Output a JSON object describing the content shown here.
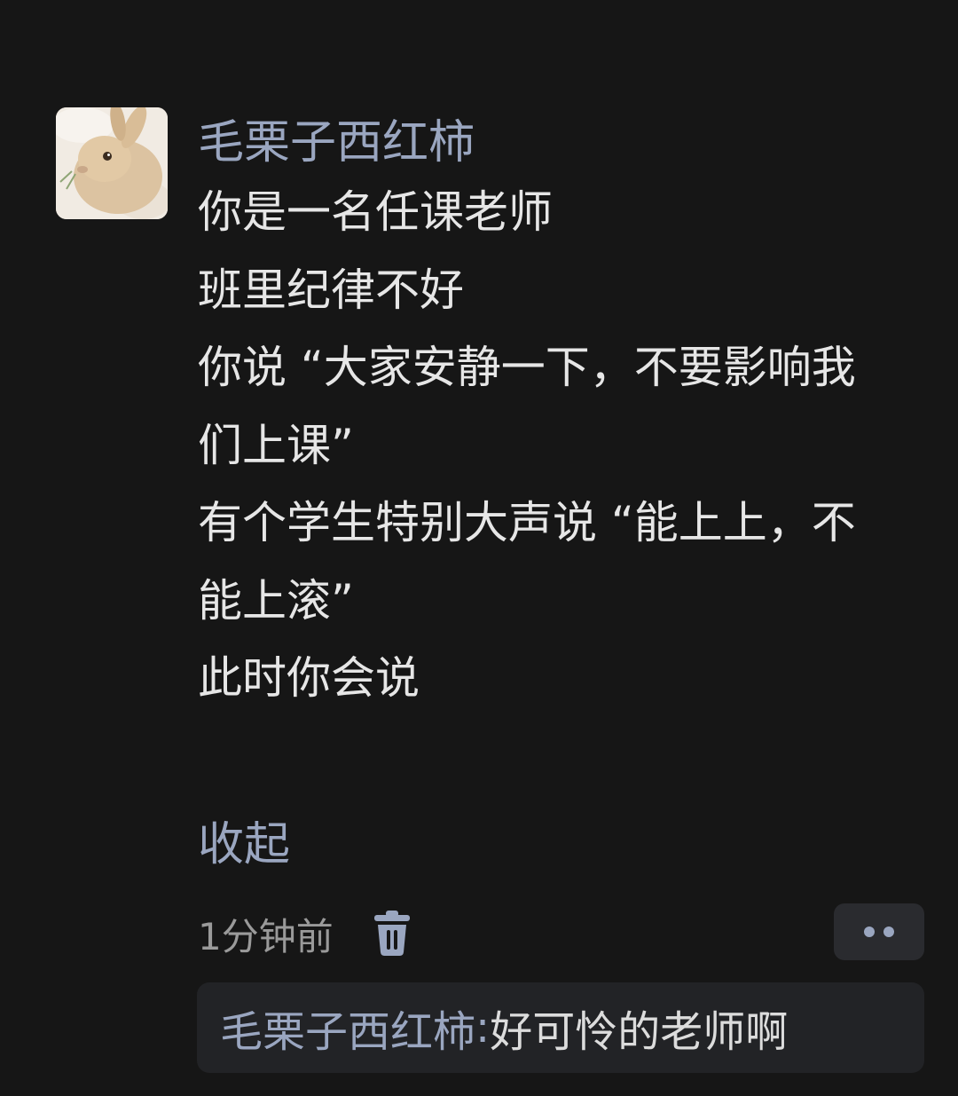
{
  "comment": {
    "author": "毛栗子西红柿",
    "lines": [
      "你是一名任课老师",
      "班里纪律不好",
      "你说 “大家安静一下，不要影响我",
      "们上课”",
      "有个学生特别大声说 “能上上，不",
      "能上滚”",
      "此时你会说"
    ],
    "collapse_label": "收起",
    "timestamp": "1分钟前"
  },
  "icons": {
    "delete": "trash-icon",
    "more": "more-dots-icon"
  },
  "reply": {
    "author": "毛栗子西红柿",
    "separator": ":",
    "text": "好可怜的老师啊"
  },
  "colors": {
    "background": "#161616",
    "accent": "#9aa6c0",
    "text": "#e6e6e6",
    "muted": "#9a9a9a",
    "panel": "#222326"
  }
}
